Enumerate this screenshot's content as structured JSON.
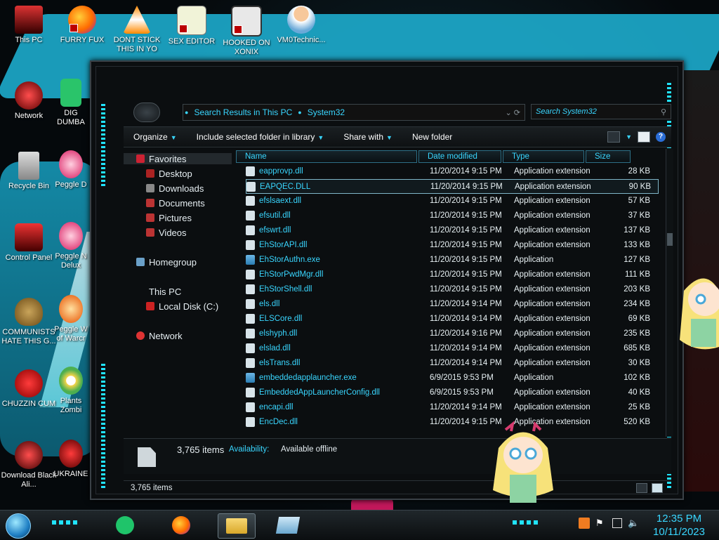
{
  "desktop": {
    "icons": [
      {
        "label": "This PC"
      },
      {
        "label": "FURRY FUX"
      },
      {
        "label": "DONT STICK THIS IN YO"
      },
      {
        "label": "SEX EDITOR"
      },
      {
        "label": "HOOKED ON XONIX"
      },
      {
        "label": "VM0Technic..."
      },
      {
        "label": "Network"
      },
      {
        "label": "Recycle Bin"
      },
      {
        "label": "Control Panel"
      },
      {
        "label": "COMMUNISTS HATE THIS G..."
      },
      {
        "label": "CHUZZIN CUM"
      },
      {
        "label": "Download Black Ali..."
      },
      {
        "label": "DIG DUMBA"
      },
      {
        "label": "Peggle D"
      },
      {
        "label": "Peggle N Delux"
      },
      {
        "label": "Peggle W of Warcr"
      },
      {
        "label": "Plants Zombi"
      },
      {
        "label": "UKRAINE"
      }
    ]
  },
  "explorer": {
    "address": {
      "part1": "Search Results in This PC",
      "part2": "System32"
    },
    "search_placeholder": "Search System32",
    "toolbar": {
      "organize": "Organize",
      "include": "Include selected folder in library",
      "share": "Share with",
      "new_folder": "New folder"
    },
    "nav": {
      "favorites": "Favorites",
      "desktop": "Desktop",
      "downloads": "Downloads",
      "documents": "Documents",
      "pictures": "Pictures",
      "videos": "Videos",
      "homegroup": "Homegroup",
      "this_pc": "This PC",
      "local_disk": "Local Disk (C:)",
      "network": "Network"
    },
    "columns": {
      "name": "Name",
      "date": "Date modified",
      "type": "Type",
      "size": "Size"
    },
    "files": [
      {
        "name": "eapprovp.dll",
        "date": "11/20/2014 9:15 PM",
        "type": "Application extension",
        "size": "28 KB"
      },
      {
        "name": "EAPQEC.DLL",
        "date": "11/20/2014 9:15 PM",
        "type": "Application extension",
        "size": "90 KB"
      },
      {
        "name": "efslsaext.dll",
        "date": "11/20/2014 9:15 PM",
        "type": "Application extension",
        "size": "57 KB"
      },
      {
        "name": "efsutil.dll",
        "date": "11/20/2014 9:15 PM",
        "type": "Application extension",
        "size": "37 KB"
      },
      {
        "name": "efswrt.dll",
        "date": "11/20/2014 9:15 PM",
        "type": "Application extension",
        "size": "137 KB"
      },
      {
        "name": "EhStorAPI.dll",
        "date": "11/20/2014 9:15 PM",
        "type": "Application extension",
        "size": "133 KB"
      },
      {
        "name": "EhStorAuthn.exe",
        "date": "11/20/2014 9:15 PM",
        "type": "Application",
        "size": "127 KB"
      },
      {
        "name": "EhStorPwdMgr.dll",
        "date": "11/20/2014 9:15 PM",
        "type": "Application extension",
        "size": "111 KB"
      },
      {
        "name": "EhStorShell.dll",
        "date": "11/20/2014 9:15 PM",
        "type": "Application extension",
        "size": "203 KB"
      },
      {
        "name": "els.dll",
        "date": "11/20/2014 9:14 PM",
        "type": "Application extension",
        "size": "234 KB"
      },
      {
        "name": "ELSCore.dll",
        "date": "11/20/2014 9:14 PM",
        "type": "Application extension",
        "size": "69 KB"
      },
      {
        "name": "elshyph.dll",
        "date": "11/20/2014 9:16 PM",
        "type": "Application extension",
        "size": "235 KB"
      },
      {
        "name": "elslad.dll",
        "date": "11/20/2014 9:14 PM",
        "type": "Application extension",
        "size": "685 KB"
      },
      {
        "name": "elsTrans.dll",
        "date": "11/20/2014 9:14 PM",
        "type": "Application extension",
        "size": "30 KB"
      },
      {
        "name": "embeddedapplauncher.exe",
        "date": "6/9/2015 9:53 PM",
        "type": "Application",
        "size": "102 KB"
      },
      {
        "name": "EmbeddedAppLauncherConfig.dll",
        "date": "6/9/2015 9:53 PM",
        "type": "Application extension",
        "size": "40 KB"
      },
      {
        "name": "encapi.dll",
        "date": "11/20/2014 9:14 PM",
        "type": "Application extension",
        "size": "25 KB"
      },
      {
        "name": "EncDec.dll",
        "date": "11/20/2014 9:15 PM",
        "type": "Application extension",
        "size": "520 KB"
      }
    ],
    "details": {
      "count": "3,765 items",
      "availability_label": "Availability:",
      "availability_value": "Available offline"
    },
    "status": "3,765 items"
  },
  "taskbar": {
    "time": "12:35 PM",
    "date": "10/11/2023"
  },
  "colors": {
    "accent": "#39d6ff",
    "frame": "#3a4147",
    "background": "#0b0e10"
  }
}
